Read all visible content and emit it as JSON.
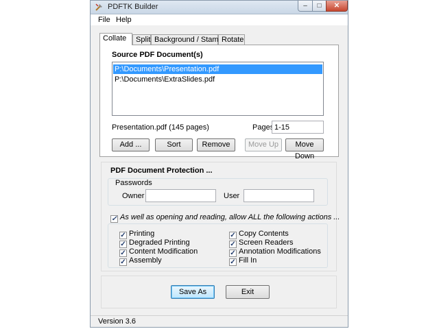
{
  "window": {
    "title": "PDFTK Builder",
    "minimize_glyph": "–",
    "maximize_glyph": "□",
    "close_glyph": "✕"
  },
  "menu": {
    "file": "File",
    "help": "Help"
  },
  "tabs": [
    {
      "label": "Collate",
      "active": true
    },
    {
      "label": "Split",
      "active": false
    },
    {
      "label": "Background / Stamp",
      "active": false
    },
    {
      "label": "Rotate",
      "active": false
    }
  ],
  "collate": {
    "source_label": "Source PDF Document(s)",
    "files": [
      {
        "path": "P:\\Documents\\Presentation.pdf",
        "selected": true
      },
      {
        "path": "P:\\Documents\\ExtraSlides.pdf",
        "selected": false
      }
    ],
    "file_info": "Presentation.pdf  (145 pages)",
    "pages_label": "Pages",
    "pages_value": "1-15",
    "buttons": {
      "add": "Add ...",
      "sort": "Sort",
      "remove": "Remove",
      "move_up": "Move Up",
      "move_down": "Move Down"
    }
  },
  "protection": {
    "title": "PDF Document Protection ...",
    "passwords_label": "Passwords",
    "owner_label": "Owner",
    "owner_value": "",
    "user_label": "User",
    "user_value": "",
    "allow_label": "As well as opening and reading, allow ALL the following actions ...",
    "allow_checked": true,
    "permissions_left": [
      {
        "label": "Printing",
        "checked": true
      },
      {
        "label": "Degraded Printing",
        "checked": true
      },
      {
        "label": "Content Modification",
        "checked": true
      },
      {
        "label": "Assembly",
        "checked": true
      }
    ],
    "permissions_right": [
      {
        "label": "Copy Contents",
        "checked": true
      },
      {
        "label": "Screen Readers",
        "checked": true
      },
      {
        "label": "Annotation Modifications",
        "checked": true
      },
      {
        "label": "Fill In",
        "checked": true
      }
    ],
    "check_glyph": "✓"
  },
  "actions": {
    "save_as": "Save As",
    "exit": "Exit"
  },
  "status": {
    "version": "Version 3.6"
  },
  "colors": {
    "selection": "#3399ff",
    "title_bar": "#c9d7e6",
    "close_button": "#c7462f"
  }
}
